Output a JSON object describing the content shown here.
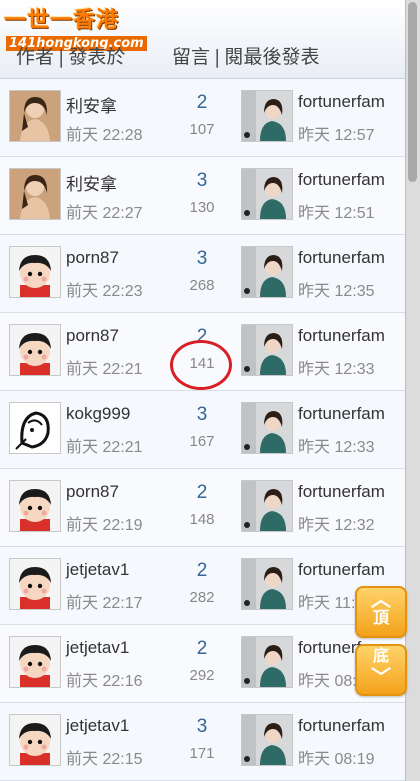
{
  "logo": {
    "main": "一世一香港",
    "sub": "141hongkong.com"
  },
  "columns": {
    "author": "作者",
    "posted": "發表於",
    "replies": "留言",
    "views": "閱",
    "last_post": "最後發表",
    "separator": "|"
  },
  "threads": [
    {
      "author": "利安拿",
      "post_time": "前天 22:28",
      "replies": "2",
      "views": "107",
      "last_poster": "fortunerfam",
      "last_time": "昨天 12:57",
      "avatar": "woman-photo-avatar"
    },
    {
      "author": "利安拿",
      "post_time": "前天 22:27",
      "replies": "3",
      "views": "130",
      "last_poster": "fortunerfam",
      "last_time": "昨天 12:51",
      "avatar": "woman-photo-avatar"
    },
    {
      "author": "porn87",
      "post_time": "前天 22:23",
      "replies": "3",
      "views": "268",
      "last_poster": "fortunerfam",
      "last_time": "昨天 12:35",
      "avatar": "cartoon-boy-avatar"
    },
    {
      "author": "porn87",
      "post_time": "前天 22:21",
      "replies": "2",
      "views": "141",
      "last_poster": "fortunerfam",
      "last_time": "昨天 12:33",
      "avatar": "cartoon-boy-avatar"
    },
    {
      "author": "kokg999",
      "post_time": "前天 22:21",
      "replies": "3",
      "views": "167",
      "last_poster": "fortunerfam",
      "last_time": "昨天 12:33",
      "avatar": "sketch-avatar"
    },
    {
      "author": "porn87",
      "post_time": "前天 22:19",
      "replies": "2",
      "views": "148",
      "last_poster": "fortunerfam",
      "last_time": "昨天 12:32",
      "avatar": "cartoon-boy-avatar"
    },
    {
      "author": "jetjetav1",
      "post_time": "前天 22:17",
      "replies": "2",
      "views": "282",
      "last_poster": "fortunerfam",
      "last_time": "昨天 11:49",
      "avatar": "cartoon-boy-avatar"
    },
    {
      "author": "jetjetav1",
      "post_time": "前天 22:16",
      "replies": "2",
      "views": "292",
      "last_poster": "fortunerfam",
      "last_time": "昨天 08:25",
      "avatar": "cartoon-boy-avatar"
    },
    {
      "author": "jetjetav1",
      "post_time": "前天 22:15",
      "replies": "3",
      "views": "171",
      "last_poster": "fortunerfam",
      "last_time": "昨天 08:19",
      "avatar": "cartoon-boy-avatar"
    }
  ],
  "nav": {
    "top_label": "頂",
    "bottom_label": "底"
  },
  "colors": {
    "accent_orange": "#f3a21a",
    "reply_blue": "#336699",
    "annotation_red": "#d81f26"
  }
}
